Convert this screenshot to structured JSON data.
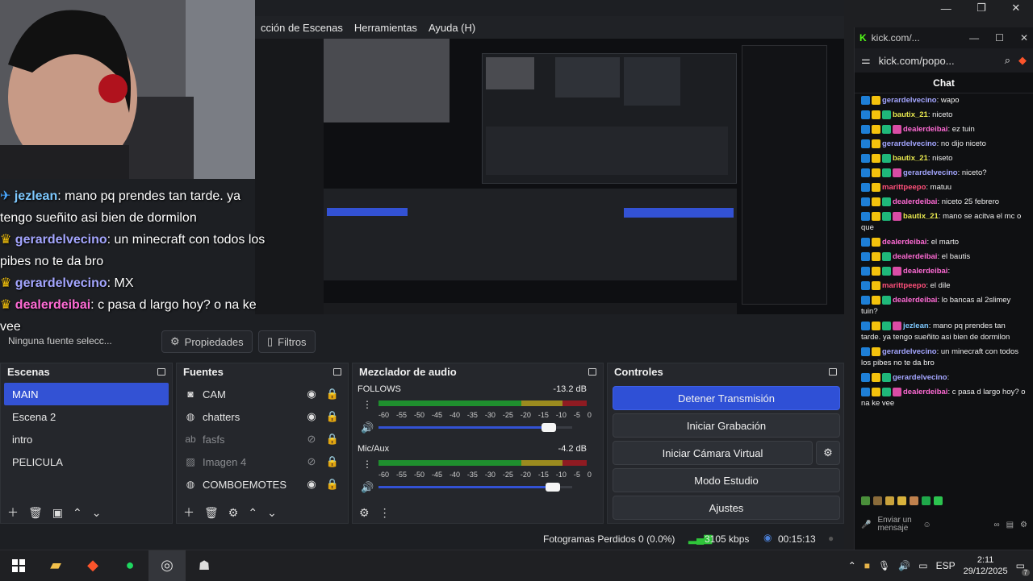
{
  "window_controls": {
    "minimize": "—",
    "maximize": "❐",
    "close": "✕"
  },
  "obs": {
    "menu": [
      "cción de Escenas",
      "Herramientas",
      "Ayuda (H)"
    ],
    "overlay_chat": [
      {
        "user": "jezlean",
        "text": ": mano pq prendes tan tarde. ya tengo sueñito asi bien de dormilon",
        "color": "#7ec9ff"
      },
      {
        "user": "gerardelvecino",
        "text": ": un minecraft con todos los pibes no te da bro",
        "color": "#a4a6ff"
      },
      {
        "user": "gerardelvecino",
        "text": ": MX",
        "color": "#a4a6ff"
      },
      {
        "user": "dealerdeibai",
        "text": ": c pasa d largo hoy? o na ke vee",
        "color": "#ff6bd5"
      }
    ],
    "tabs": {
      "no_source": "Ninguna fuente selecc...",
      "properties": "Propiedades",
      "filters": "Filtros"
    },
    "scenes": {
      "title": "Escenas",
      "items": [
        "MAIN",
        "Escena 2",
        "intro",
        "PELICULA"
      ]
    },
    "sources": {
      "title": "Fuentes",
      "items": [
        {
          "name": "CAM",
          "icon": "camera-icon",
          "visible": true
        },
        {
          "name": "chatters",
          "icon": "browser-icon",
          "visible": true
        },
        {
          "name": "fasfs",
          "icon": "text-icon",
          "visible": false
        },
        {
          "name": "Imagen 4",
          "icon": "image-icon",
          "visible": false
        },
        {
          "name": "COMBOEMOTES",
          "icon": "browser-icon",
          "visible": true
        }
      ]
    },
    "mixer": {
      "title": "Mezclador de audio",
      "channels": [
        {
          "name": "FOLLOWS",
          "db": "-13.2 dB",
          "level": 0.88
        },
        {
          "name": "Mic/Aux",
          "db": "-4.2 dB",
          "level": 0.9
        }
      ],
      "scale": [
        "-60",
        "-55",
        "-50",
        "-45",
        "-40",
        "-35",
        "-30",
        "-25",
        "-20",
        "-15",
        "-10",
        "-5",
        "0"
      ]
    },
    "controls": {
      "title": "Controles",
      "stop_stream": "Detener Transmisión",
      "start_rec": "Iniciar Grabación",
      "virtual_cam": "Iniciar Cámara Virtual",
      "studio": "Modo Estudio",
      "settings": "Ajustes"
    },
    "status": {
      "dropped": "Fotogramas Perdidos 0 (0.0%)",
      "kbps": "3105 kbps",
      "time": "00:15:13"
    }
  },
  "kick": {
    "title": "kick.com/...",
    "url": "kick.com/popo...",
    "chat_title": "Chat",
    "messages": [
      {
        "user": "gerardelvecino",
        "text": ": wapo",
        "color": "#a4a6ff"
      },
      {
        "user": "bautix_21",
        "text": ": niceto",
        "color": "#e8e84f"
      },
      {
        "user": "dealerdeibai",
        "text": ": ez tuin",
        "color": "#ff6bd5"
      },
      {
        "user": "gerardelvecino",
        "text": ": no dijo niceto",
        "color": "#a4a6ff"
      },
      {
        "user": "bautix_21",
        "text": ": niseto",
        "color": "#e8e84f"
      },
      {
        "user": "gerardelvecino",
        "text": ": niceto?",
        "color": "#a4a6ff"
      },
      {
        "user": "marittpeepo",
        "text": ": matuu",
        "color": "#ff4f7a"
      },
      {
        "user": "dealerdeibai",
        "text": ": niceto 25 febrero",
        "color": "#ff6bd5"
      },
      {
        "user": "bautix_21",
        "text": ": mano se acitva el mc o que",
        "color": "#e8e84f"
      },
      {
        "user": "dealerdeibai",
        "text": ": el marto",
        "color": "#ff6bd5"
      },
      {
        "user": "dealerdeibai",
        "text": ": el bautis",
        "color": "#ff6bd5"
      },
      {
        "user": "dealerdeibai",
        "text": ":",
        "color": "#ff6bd5"
      },
      {
        "user": "marittpeepo",
        "text": ": el dile",
        "color": "#ff4f7a"
      },
      {
        "user": "dealerdeibai",
        "text": ": lo bancas al 2slimey tuin?",
        "color": "#ff6bd5"
      },
      {
        "user": "jezlean",
        "text": ": mano pq prendes tan tarde. ya tengo sueñito asi bien de dormilon",
        "color": "#7ec9ff"
      },
      {
        "user": "gerardelvecino",
        "text": ": un minecraft con todos los pibes no te da bro",
        "color": "#a4a6ff"
      },
      {
        "user": "gerardelvecino",
        "text": ":",
        "color": "#a4a6ff"
      },
      {
        "user": "dealerdeibai",
        "text": ": c pasa d largo hoy? o na ke vee",
        "color": "#ff6bd5"
      }
    ],
    "input_placeholder": "Enviar un mensaje"
  },
  "taskbar": {
    "lang": "ESP",
    "time": "2:11",
    "date": "29/12/2025",
    "notif_count": "7"
  }
}
